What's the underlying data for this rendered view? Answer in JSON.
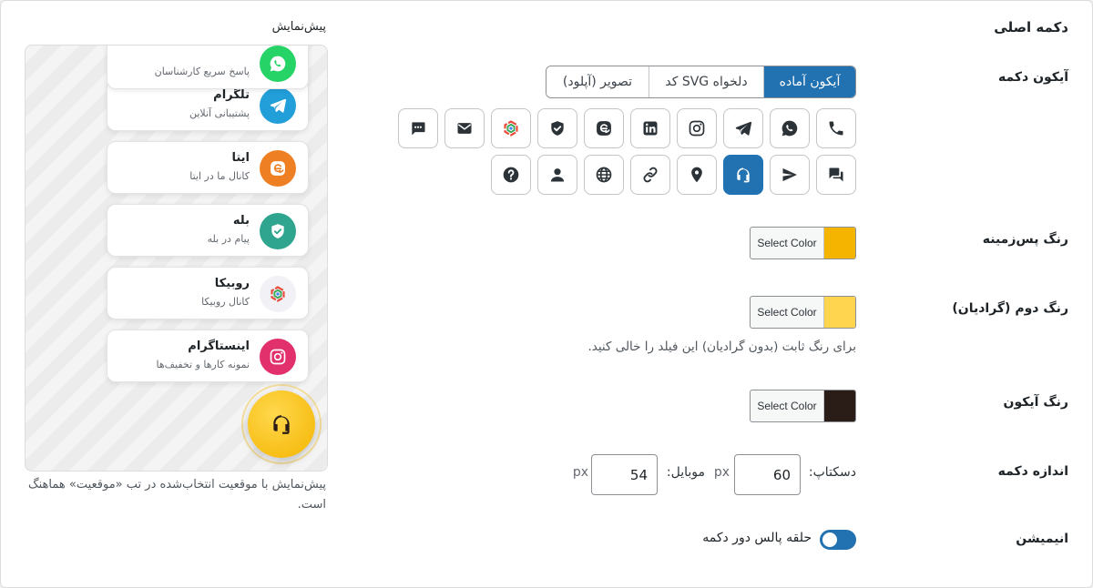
{
  "section_title": "دکمه اصلی",
  "labels": {
    "button_icon": "آیکون دکمه",
    "bg_color": "رنگ پس‌زمینه",
    "second_color": "رنگ دوم (گرادیان)",
    "icon_color": "رنگ آیکون",
    "button_size": "اندازه دکمه",
    "animation": "انیمیشن"
  },
  "tabs": [
    {
      "label": "آیکون آماده",
      "active": true
    },
    {
      "label": "کد SVG دلخواه",
      "active": false
    },
    {
      "label": "تصویر (آپلود)",
      "active": false
    }
  ],
  "icons_row1": [
    "phone-icon",
    "whatsapp-icon",
    "telegram-icon",
    "instagram-icon",
    "linkedin-icon",
    "eitaa-icon",
    "bale-icon",
    "rubika-icon",
    "email-icon",
    "chat-dots-icon"
  ],
  "icons_row2": [
    "chat-bubbles-icon",
    "send-icon",
    "headset-icon",
    "location-pin-icon",
    "link-icon",
    "globe-icon",
    "user-icon",
    "question-icon"
  ],
  "selected_icon": "headset-icon",
  "color_picker_label": "Select Color",
  "colors": {
    "background": "#f4b400",
    "second": "#ffd54f",
    "icon": "#2a1d17",
    "accent": "#2271b1"
  },
  "gradient_help": "برای رنگ ثابت (بدون گرادیان) این فیلد را خالی کنید.",
  "size": {
    "desktop_label": "دسکتاپ:",
    "desktop_value": "60",
    "mobile_label": "موبایل:",
    "mobile_value": "54",
    "unit": "px"
  },
  "animation_toggle": {
    "on": true,
    "label": "حلقه پالس دور دکمه"
  },
  "preview": {
    "title": "پیش‌نمایش",
    "items": [
      {
        "title": "",
        "subtitle": "پاسخ سریع کارشناسان",
        "icon": "whatsapp-icon",
        "color": "#25d366"
      },
      {
        "title": "تلگرام",
        "subtitle": "پشتیبانی آنلاین",
        "icon": "telegram-icon",
        "color": "#229ed9"
      },
      {
        "title": "ایتا",
        "subtitle": "کانال ما در ایتا",
        "icon": "eitaa-icon",
        "color": "#ee7f23"
      },
      {
        "title": "بله",
        "subtitle": "پیام در بله",
        "icon": "bale-icon",
        "color": "#2fa58f"
      },
      {
        "title": "روبیکا",
        "subtitle": "کانال روبیکا",
        "icon": "rubika-icon",
        "color": "#f1f1f6"
      },
      {
        "title": "اینستاگرام",
        "subtitle": "نمونه کارها و تخفیف‌ها",
        "icon": "instagram-icon",
        "color": "#e1306c"
      }
    ],
    "note": "پیش‌نمایش با موقعیت انتخاب‌شده در تب «موقعیت» هماهنگ است."
  }
}
